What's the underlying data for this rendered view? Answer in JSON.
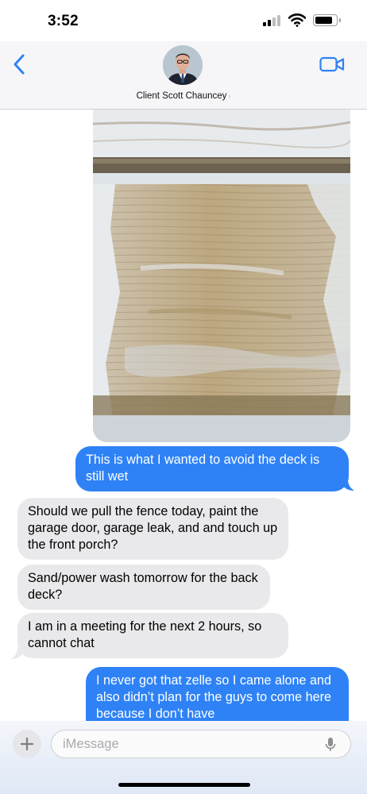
{
  "status_bar": {
    "time": "3:52"
  },
  "header": {
    "contact_name": "Client Scott Chauncey",
    "chevron": "›"
  },
  "icons": {
    "back": "chevron-left-icon",
    "video": "video-camera-icon",
    "signal": "cellular-signal-icon",
    "wifi": "wifi-icon",
    "battery": "battery-icon",
    "plus": "plus-icon",
    "mic": "microphone-icon"
  },
  "colors": {
    "accent": "#2e82f6",
    "incoming_bubble": "#e9e9eb",
    "outgoing_text": "#ffffff"
  },
  "messages": [
    {
      "direction": "out",
      "text": "This is what I wanted to avoid the deck is still wet"
    },
    {
      "direction": "in",
      "text": "Should we pull the fence today, paint the garage door, garage leak, and and touch up the front porch?"
    },
    {
      "direction": "in",
      "text": "Sand/power wash tomorrow for the back deck?"
    },
    {
      "direction": "in",
      "text": "I am in a meeting for the next 2 hours, so cannot chat"
    },
    {
      "direction": "out",
      "text": "I never got that zelle so I came alone and also didn’t plan for the guys to come here because I don’t have"
    }
  ],
  "input": {
    "placeholder": "iMessage",
    "value": ""
  }
}
